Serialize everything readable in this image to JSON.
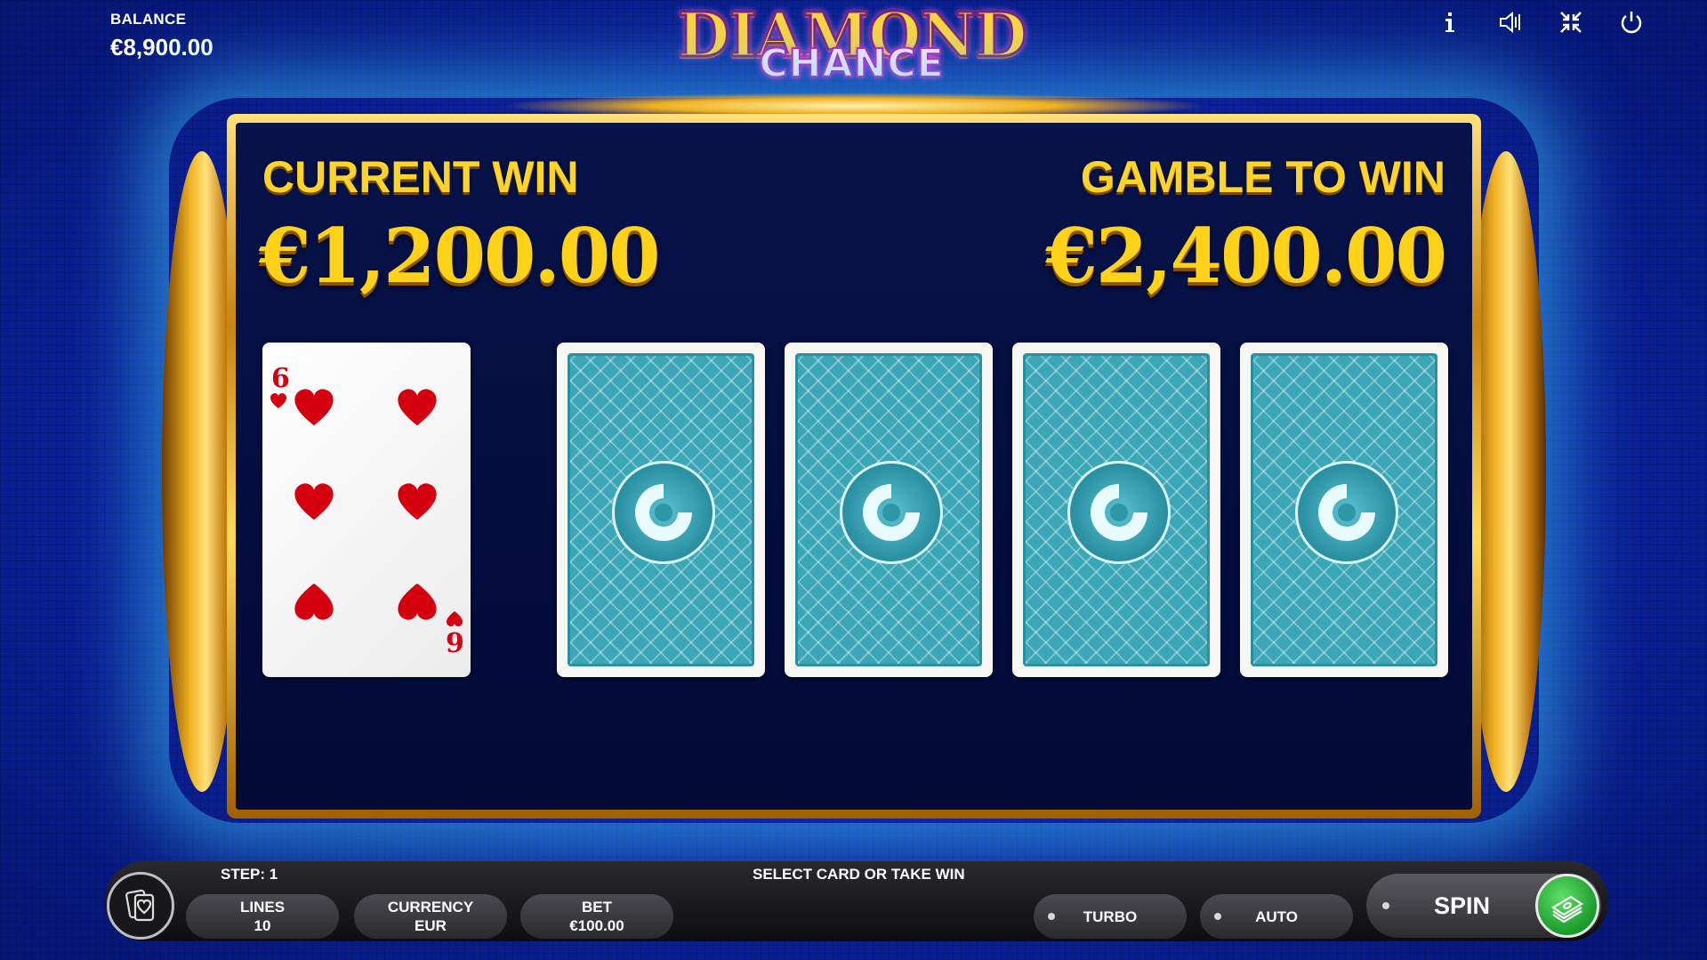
{
  "balance": {
    "label": "BALANCE",
    "value": "€8,900.00"
  },
  "logo": {
    "line1": "DIAMOND",
    "line2": "CHANCE"
  },
  "top_icons": [
    "info-icon",
    "sound-icon",
    "fullscreen-exit-icon",
    "power-icon"
  ],
  "gamble": {
    "current_win_label": "CURRENT WIN",
    "current_win_amount": "€1,200.00",
    "gamble_to_win_label": "GAMBLE TO WIN",
    "gamble_to_win_amount": "€2,400.00"
  },
  "dealer_card": {
    "rank": "6",
    "suit": "hearts"
  },
  "hidden_cards_count": 4,
  "status": {
    "step": "STEP: 1",
    "message": "SELECT CARD OR TAKE WIN"
  },
  "controls": {
    "lines_label": "LINES",
    "lines_value": "10",
    "currency_label": "CURRENCY",
    "currency_value": "EUR",
    "bet_label": "BET",
    "bet_value": "€100.00",
    "turbo_label": "TURBO",
    "auto_label": "AUTO",
    "spin_label": "SPIN"
  },
  "colors": {
    "gold": "#ffd21a",
    "card_back": "#3aa6b6",
    "suit_red": "#d4000f",
    "spin_green": "#2bbf3a"
  }
}
